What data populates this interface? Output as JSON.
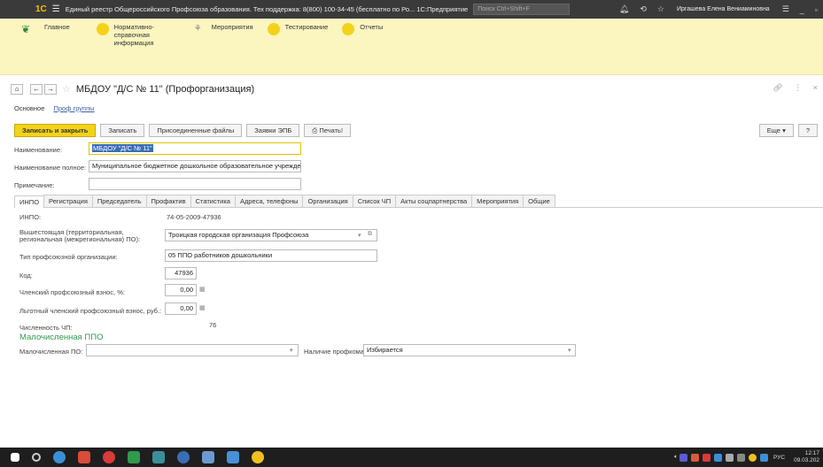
{
  "titlebar": {
    "logo": "1С",
    "title": "Единый реестр Общероссийского Профсоюза образования. Тех поддержка: 8(800) 100-34-45 (бесплатно по Ро...  1С:Предприятие",
    "search_placeholder": "Поиск Ctrl+Shift+F",
    "user": "Иргашева Елена Вениаминовна"
  },
  "sections": [
    {
      "label": "Главное"
    },
    {
      "label": "Нормативно-справочная информация"
    },
    {
      "label": "Мероприятия"
    },
    {
      "label": "Тестирование"
    },
    {
      "label": "Отчеты"
    }
  ],
  "form": {
    "title": "МБДОУ \"Д/С № 11\" (Профорганизация)",
    "subtab_main": "Основное",
    "subtab_groups": "Проф группы"
  },
  "toolbar": {
    "save_close": "Записать и закрыть",
    "save": "Записать",
    "attached": "Присоединенные файлы",
    "epb": "Заявки ЭПБ",
    "print": "Печать!",
    "more": "Еще",
    "help": "?"
  },
  "fields": {
    "name_label": "Наименование:",
    "name_value": "МБДОУ \"Д/С № 11\"",
    "fullname_label": "Наименование полное:",
    "fullname_value": "Муниципальное бюджетное дошкольное образовательное учрежде",
    "note_label": "Примечание:",
    "note_value": ""
  },
  "tabs": [
    "ИНПО",
    "Регистрация",
    "Председатель",
    "Профактив",
    "Статистика",
    "Адреса, телефоны",
    "Организация",
    "Список ЧП",
    "Акты соцпартнерства",
    "Мероприятия",
    "Общие"
  ],
  "inpo": {
    "inpo_label": "ИНПО:",
    "inpo_value": "74-05-2009-47936",
    "parent_label_1": "Вышестоящая (территориальная,",
    "parent_label_2": "региональная (межрегиональная) ПО):",
    "parent_value": "Троицкая городская организация Профсоюза",
    "type_label": "Тип профсоюзной организации:",
    "type_value": "05 ППО работников дошкольники",
    "code_label": "Код:",
    "code_value": "47936",
    "fee_label": "Членский профсоюзный взнос, %:",
    "fee_value": "0,00",
    "pref_fee_label": "Льготный членский профсоюзный взнос, руб.:",
    "pref_fee_value": "0,00",
    "members_label": "Численность ЧП:",
    "members_value": "76",
    "small_heading": "Малочисленная ППО",
    "small_label": "Малочисленная ПО:",
    "small_value": "",
    "committee_label": "Наличие профкома:",
    "committee_value": "Избирается"
  },
  "tray": {
    "lang": "РУС",
    "time": "12:17",
    "date": "09.03.202"
  }
}
